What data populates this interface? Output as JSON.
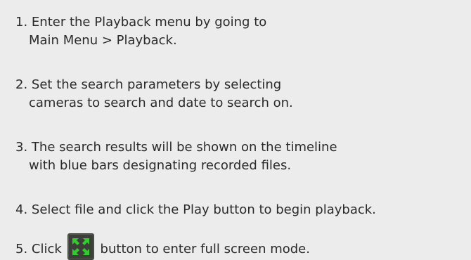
{
  "steps": [
    {
      "number": "1.",
      "line1": "Enter the Playback menu by going to",
      "line2": "Main Menu > Playback."
    },
    {
      "number": "2.",
      "line1": "Set the search parameters by selecting",
      "line2": "cameras to search and date to search on."
    },
    {
      "number": "3.",
      "line1": "The search results will be shown on the timeline",
      "line2": "with blue bars designating recorded files."
    },
    {
      "number": "4.",
      "line1": "Select file and click the Play button to begin playback."
    },
    {
      "number": "5.",
      "before_icon": "Click",
      "after_icon": "button to enter full screen mode.",
      "icon": "fullscreen-icon"
    }
  ],
  "colors": {
    "background": "#ececec",
    "text": "#2a2a2a",
    "icon_bg": "#3b3f38",
    "icon_arrows": "#35c832"
  }
}
